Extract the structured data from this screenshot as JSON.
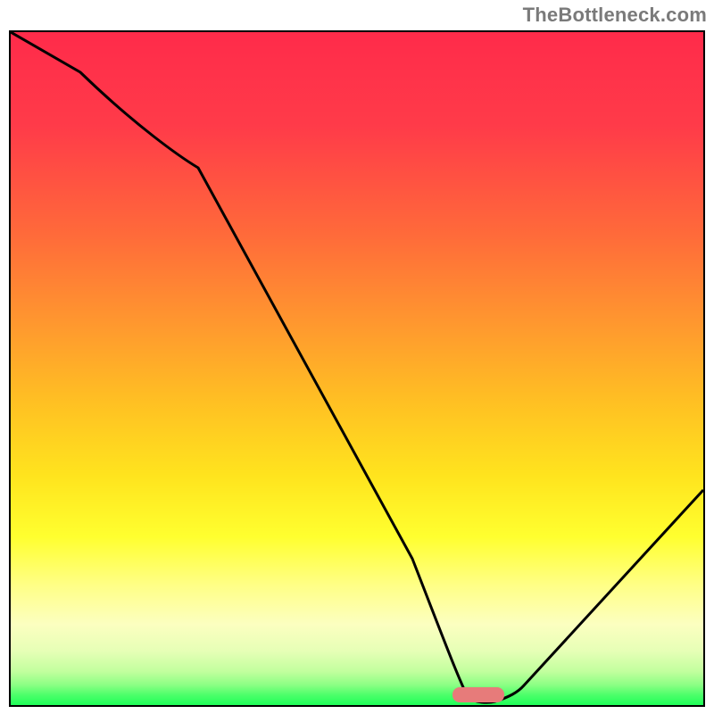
{
  "watermark": "TheBottleneck.com",
  "chart_data": {
    "type": "line",
    "title": "",
    "xlabel": "",
    "ylabel": "",
    "xlim": [
      0,
      100
    ],
    "ylim": [
      0,
      100
    ],
    "x": [
      0,
      10,
      27,
      58,
      64,
      66,
      70,
      74,
      100
    ],
    "values": [
      100,
      94,
      80,
      22,
      5,
      1,
      0,
      1,
      32
    ],
    "optimum_marker": {
      "x_start": 64,
      "x_end": 72,
      "y": 0,
      "color": "#e77b7a"
    },
    "gradient_stops": [
      {
        "pos": 0,
        "color": "#ff2b4a"
      },
      {
        "pos": 14,
        "color": "#ff3b49"
      },
      {
        "pos": 30,
        "color": "#ff6a3a"
      },
      {
        "pos": 44,
        "color": "#ff9a2e"
      },
      {
        "pos": 55,
        "color": "#ffc023"
      },
      {
        "pos": 66,
        "color": "#ffe41e"
      },
      {
        "pos": 75,
        "color": "#ffff2f"
      },
      {
        "pos": 82,
        "color": "#ffff84"
      },
      {
        "pos": 88,
        "color": "#fcffc0"
      },
      {
        "pos": 92,
        "color": "#e6ffb6"
      },
      {
        "pos": 95,
        "color": "#c2ff9e"
      },
      {
        "pos": 97,
        "color": "#8cff84"
      },
      {
        "pos": 98.5,
        "color": "#4cff6a"
      },
      {
        "pos": 100,
        "color": "#1fff58"
      }
    ],
    "grid": false,
    "legend": false
  }
}
